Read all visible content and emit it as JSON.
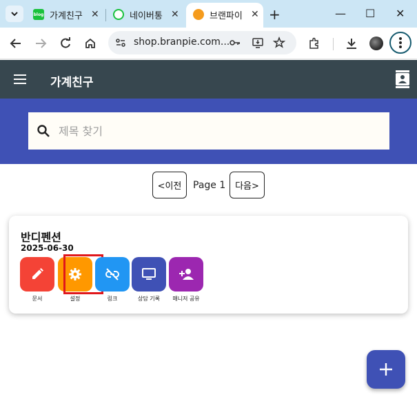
{
  "browser": {
    "tabs": [
      {
        "title": "가계친구",
        "favicon": "blog-icon",
        "color": "#19c13c"
      },
      {
        "title": "네이버통",
        "favicon": "naver-icon",
        "color": "#19c13c"
      },
      {
        "title": "브랜파이",
        "favicon": "branpie-icon",
        "color": "#f59b1c"
      }
    ],
    "address": "shop.branpie.com..."
  },
  "app": {
    "title": "가계친구"
  },
  "search": {
    "placeholder": "제목 찾기",
    "value": ""
  },
  "pagination": {
    "prev_label": "<이전",
    "page_label": "Page 1",
    "next_label": "다음>"
  },
  "card": {
    "title": "반디펜션",
    "date": "2025-06-30",
    "actions": [
      {
        "label": "문서",
        "icon": "pencil-icon",
        "color": "#f44336"
      },
      {
        "label": "설정",
        "icon": "gear-icon",
        "color": "#ff9800"
      },
      {
        "label": "링크",
        "icon": "link-off-icon",
        "color": "#2196f3"
      },
      {
        "label": "상담 기록",
        "icon": "monitor-icon",
        "color": "#3f51b5"
      },
      {
        "label": "매니저 공유",
        "icon": "person-add-icon",
        "color": "#9c27b0"
      }
    ]
  },
  "fab": {
    "label": "+"
  }
}
